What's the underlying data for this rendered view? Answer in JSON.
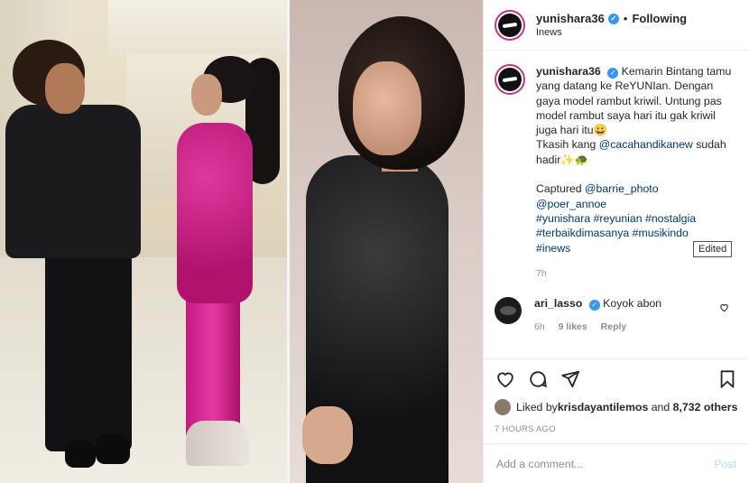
{
  "header": {
    "username": "yunishara36",
    "separator": "•",
    "follow_label": "Following",
    "location": "Inews"
  },
  "caption": {
    "username": "yunishara36",
    "text1": "Kemarin Bintang tamu yang datang ke ReYUNIan. Dengan gaya model rambut kriwil. Untung pas model rambut saya hari itu gak kriwil juga hari itu😀",
    "text2_pre": "Tkasih kang ",
    "mention1": "@cacahandikanew",
    "text2_post": " sudah hadir✨🐢",
    "captured_label": "Captured ",
    "mention2": "@barrie_photo",
    "mention3": "@poer_annoe",
    "hashtags_line1": "#yunishara #reyunian #nostalgia",
    "hashtags_line2": "#terbaikdimasanya #musikindo",
    "hashtags_line3": "#inews",
    "age": "7h",
    "tooltip": "Edited"
  },
  "comment": {
    "username": "ari_lasso",
    "text": "Koyok abon",
    "age": "6h",
    "likes": "9 likes",
    "reply": "Reply"
  },
  "likes": {
    "prefix": "Liked by ",
    "user": "krisdayantilemos",
    "middle": " and ",
    "count": "8,732 others"
  },
  "timestamp": "7 HOURS AGO",
  "add_comment": {
    "placeholder": "Add a comment...",
    "post_label": "Post"
  },
  "colors": {
    "link": "#00376b",
    "verified": "#3897f0",
    "story_ring": "#c13584"
  }
}
